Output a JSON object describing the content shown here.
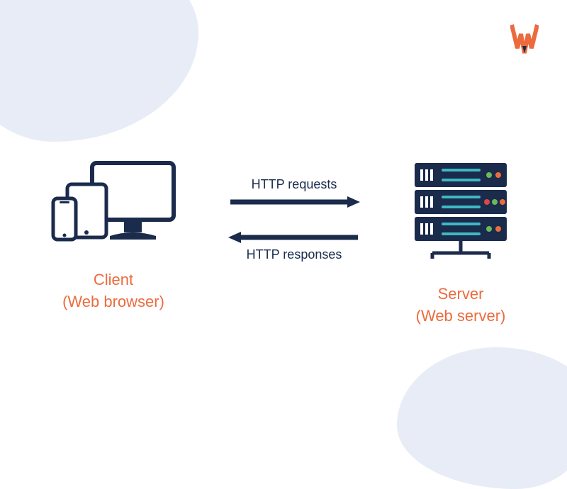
{
  "logo": {
    "letter": "W",
    "colors": {
      "primary": "#ec6b3e",
      "accent": "#1a2b4c"
    }
  },
  "client": {
    "title": "Client",
    "subtitle": "(Web browser)"
  },
  "server": {
    "title": "Server",
    "subtitle": "(Web server)"
  },
  "arrows": {
    "request_label": "HTTP requests",
    "response_label": "HTTP responses"
  },
  "colors": {
    "dark_navy": "#1a2b4c",
    "orange": "#ec6b3e",
    "blob": "#e8ecf6",
    "cyan": "#3fb8c4",
    "green": "#6bb85a",
    "red": "#d94848"
  }
}
